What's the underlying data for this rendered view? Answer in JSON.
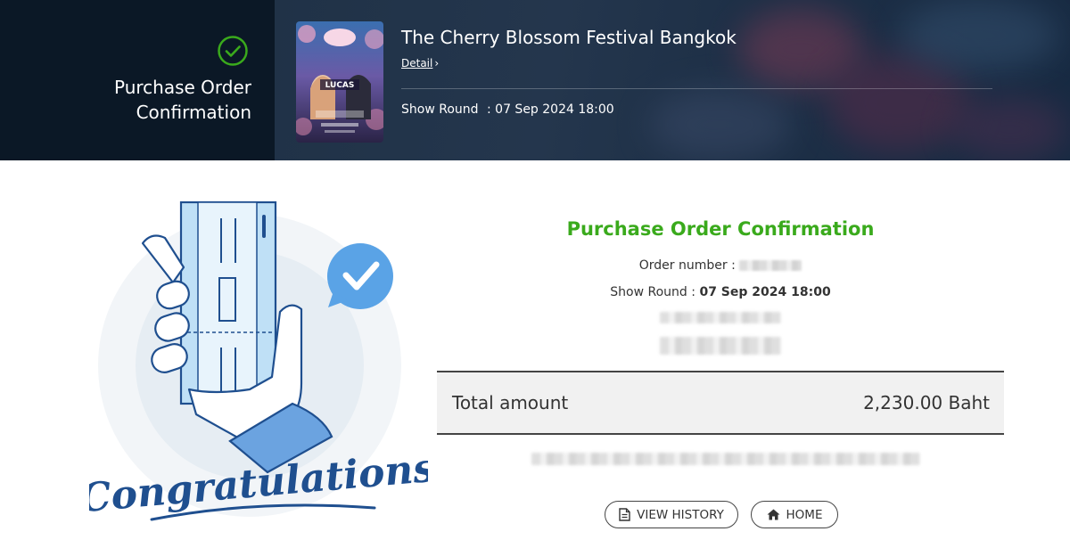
{
  "header": {
    "page_title": "Purchase Order Confirmation",
    "event_title": "The Cherry Blossom Festival Bangkok",
    "detail_link": "Detail",
    "show_round_label": "Show Round",
    "show_round_value": ": 07 Sep 2024 18:00",
    "check_icon": "check-circle-icon"
  },
  "poster": {
    "alt_icon": "event-poster-image",
    "headline": "LUCAS"
  },
  "illustration": {
    "caption": "Congratulations",
    "icon": "ticket-in-hand-illustration"
  },
  "confirmation": {
    "title": "Purchase Order Confirmation",
    "order_number_label": "Order number :",
    "show_round_label": "Show Round :",
    "show_round_value": "07 Sep 2024 18:00",
    "total_label": "Total amount",
    "total_value": "2,230.00 Baht"
  },
  "buttons": {
    "view_history": "VIEW HISTORY",
    "view_history_icon": "document-icon",
    "home": "HOME",
    "home_icon": "home-icon"
  },
  "colors": {
    "accent_green": "#3aaa1c",
    "header_dark": "#0b1826",
    "illustration_blue": "#1f4f8f"
  }
}
